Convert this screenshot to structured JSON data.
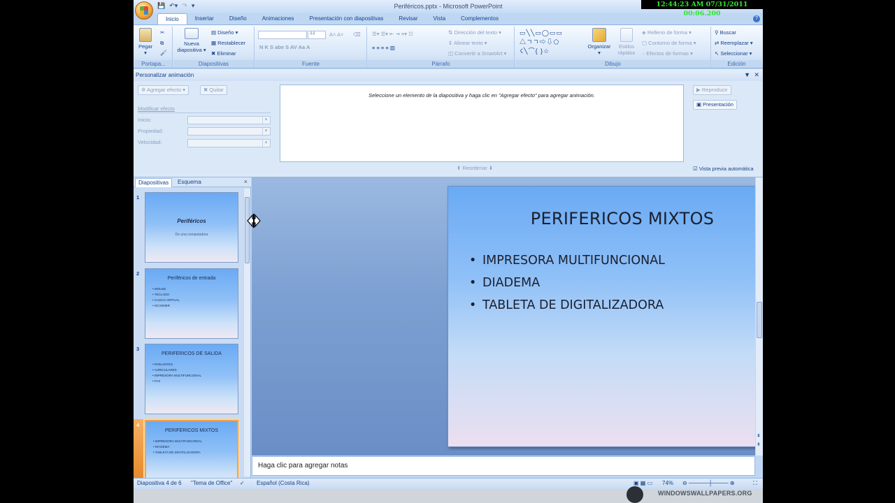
{
  "timestamp": "12:44:23 AM 07/31/2011 00:06.200",
  "window": {
    "title": "Periféricos.pptx - Microsoft PowerPoint"
  },
  "tabs": [
    "Inicio",
    "Insertar",
    "Diseño",
    "Animaciones",
    "Presentación con diapositivas",
    "Revisar",
    "Vista",
    "Complementos"
  ],
  "ribbon": {
    "groups": {
      "portapapeles": "Portapa...",
      "diapositivas": "Diapositivas",
      "fuente": "Fuente",
      "parrafo": "Párrafo",
      "dibujo": "Dibujo",
      "edicion": "Edición"
    },
    "pegar": "Pegar",
    "nueva": "Nueva",
    "diapositiva": "diapositiva",
    "diseno": "Diseño",
    "restablecer": "Restablecer",
    "eliminar": "Eliminar",
    "font_size": "44",
    "direccion": "Dirección del texto",
    "alinear": "Alinear texto",
    "convertir": "Convertir a SmartArt",
    "organizar": "Organizar",
    "estilos": "Estilos",
    "rapidos": "rápidos",
    "relleno": "Relleno de forma",
    "contorno": "Contorno de forma",
    "efectos": "Efectos de formas",
    "buscar": "Buscar",
    "reemplazar": "Reemplazar",
    "seleccionar": "Seleccionar"
  },
  "anim": {
    "header": "Personalizar animación",
    "agregar": "Agregar efecto",
    "quitar": "Quitar",
    "modificar": "Modificar efecto",
    "inicio": "Inicio:",
    "propiedad": "Propiedad:",
    "velocidad": "Velocidad:",
    "message": "Seleccione un elemento de la diapositiva y haga clic en \"Agregar efecto\" para agregar animación.",
    "reordenar": "Reordenar",
    "reproducir": "Reproducir",
    "presentacion": "Presentación",
    "vista_previa": "Vista previa automática"
  },
  "left_panel": {
    "tab1": "Diapositivas",
    "tab2": "Esquema"
  },
  "thumbs": [
    {
      "num": "1",
      "title": "Periféricos",
      "subtitle": "De una computadora",
      "bullets": []
    },
    {
      "num": "2",
      "title": "Periféricos de entrada",
      "bullets": [
        "MOUSE",
        "TECLADO",
        "CASCO VIRTUAL",
        "SCANNER"
      ]
    },
    {
      "num": "3",
      "title": "PERIFERICOS  DE SALIDA",
      "bullets": [
        "PARLANTES",
        "AURICULARES",
        "IMPRESORA  MULTIFUNCIONAL",
        "FAX"
      ]
    },
    {
      "num": "4",
      "title": "PERIFERICOS  MIXTOS",
      "bullets": [
        "IMPRESORA  MULTIFUNCIONAL",
        "DIADEMA",
        "TABLETA  DE DIGITALIZADORA"
      ]
    }
  ],
  "slide": {
    "title": "PERIFERICOS MIXTOS",
    "bullets": [
      "IMPRESORA MULTIFUNCIONAL",
      "DIADEMA",
      "TABLETA DE DIGITALIZADORA"
    ]
  },
  "notes_placeholder": "Haga clic para agregar notas",
  "status": {
    "slide": "Diapositiva 4 de 6",
    "theme": "\"Tema de Office\"",
    "language": "Español (Costa Rica)",
    "zoom": "74%"
  },
  "watermark": "WINDOWSWALLPAPERS.ORG"
}
